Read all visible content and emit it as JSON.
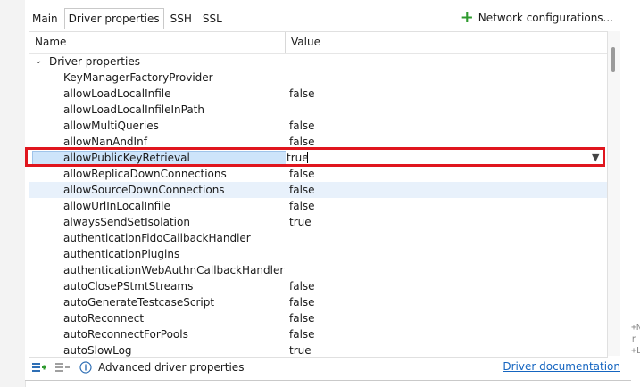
{
  "tabs": [
    {
      "label": "Main",
      "active": false
    },
    {
      "label": "Driver properties",
      "active": true
    },
    {
      "label": "SSH",
      "active": false
    },
    {
      "label": "SSL",
      "active": false
    }
  ],
  "network_config_label": "Network configurations...",
  "table": {
    "col_name": "Name",
    "col_value": "Value",
    "group_label": "Driver properties",
    "rows": [
      {
        "name": "KeyManagerFactoryProvider",
        "value": ""
      },
      {
        "name": "allowLoadLocalInfile",
        "value": "false"
      },
      {
        "name": "allowLoadLocalInfileInPath",
        "value": ""
      },
      {
        "name": "allowMultiQueries",
        "value": "false"
      },
      {
        "name": "allowNanAndInf",
        "value": "false"
      },
      {
        "name": "allowPublicKeyRetrieval",
        "value": "true"
      },
      {
        "name": "allowReplicaDownConnections",
        "value": "false"
      },
      {
        "name": "allowSourceDownConnections",
        "value": "false"
      },
      {
        "name": "allowUrlInLocalInfile",
        "value": "false"
      },
      {
        "name": "alwaysSendSetIsolation",
        "value": "true"
      },
      {
        "name": "authenticationFidoCallbackHandler",
        "value": ""
      },
      {
        "name": "authenticationPlugins",
        "value": ""
      },
      {
        "name": "authenticationWebAuthnCallbackHandler",
        "value": ""
      },
      {
        "name": "autoClosePStmtStreams",
        "value": "false"
      },
      {
        "name": "autoGenerateTestcaseScript",
        "value": "false"
      },
      {
        "name": "autoReconnect",
        "value": "false"
      },
      {
        "name": "autoReconnectForPools",
        "value": "false"
      },
      {
        "name": "autoSlowLog",
        "value": "true"
      }
    ]
  },
  "footer": {
    "advanced_label": "Advanced driver properties",
    "doc_link": "Driver documentation"
  },
  "right_fragments": [
    "+N",
    "r",
    "+L"
  ],
  "colors": {
    "highlight": "#e0161e",
    "link": "#1565c0",
    "selection": "#cde4fa",
    "hover_row": "#e8f1fb",
    "add_green": "#2e9a2e"
  }
}
